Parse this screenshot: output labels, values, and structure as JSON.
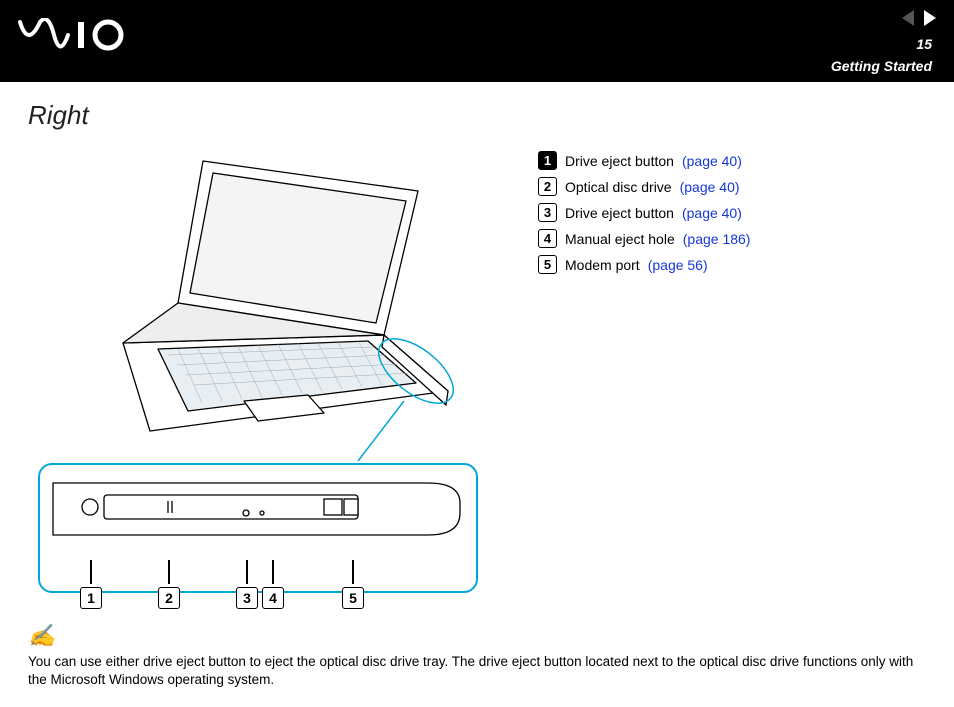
{
  "header": {
    "logo_alt": "VAIO",
    "page_number": "15",
    "section": "Getting Started"
  },
  "title": "Right",
  "legend": [
    {
      "num": "1",
      "filled": true,
      "label": "Drive eject button",
      "ref": "(page 40)"
    },
    {
      "num": "2",
      "filled": false,
      "label": "Optical disc drive",
      "ref": "(page 40)"
    },
    {
      "num": "3",
      "filled": false,
      "label": "Drive eject button",
      "ref": "(page 40)"
    },
    {
      "num": "4",
      "filled": false,
      "label": "Manual eject hole",
      "ref": "(page 186)"
    },
    {
      "num": "5",
      "filled": false,
      "label": "Modem port",
      "ref": "(page 56)"
    }
  ],
  "callouts": [
    "1",
    "2",
    "3",
    "4",
    "5"
  ],
  "note": "You can use either drive eject button to eject the optical disc drive tray. The drive eject button located next to the optical disc drive functions only with the Microsoft Windows operating system."
}
